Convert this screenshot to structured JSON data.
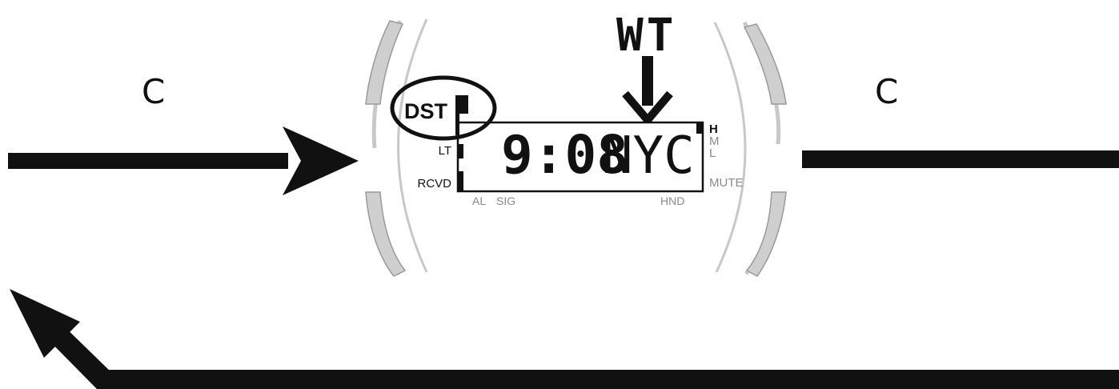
{
  "labels": {
    "button_left": "C",
    "button_right": "C",
    "mode_title": "WT"
  },
  "watch": {
    "dst": "DST",
    "lt": "LT",
    "rcvd": "RCVD",
    "al": "AL",
    "sig": "SIG",
    "hnd": "HND",
    "level_h": "H",
    "level_m": "M",
    "level_l": "L",
    "mute": "MUTE",
    "time": "9:08",
    "city": "NYC"
  },
  "colors": {
    "ink": "#111111",
    "bezel": "#c8c8c8",
    "bezel_outline": "#9a9a9a",
    "dim_text": "#8a8a8a",
    "background": "#ffffff"
  }
}
